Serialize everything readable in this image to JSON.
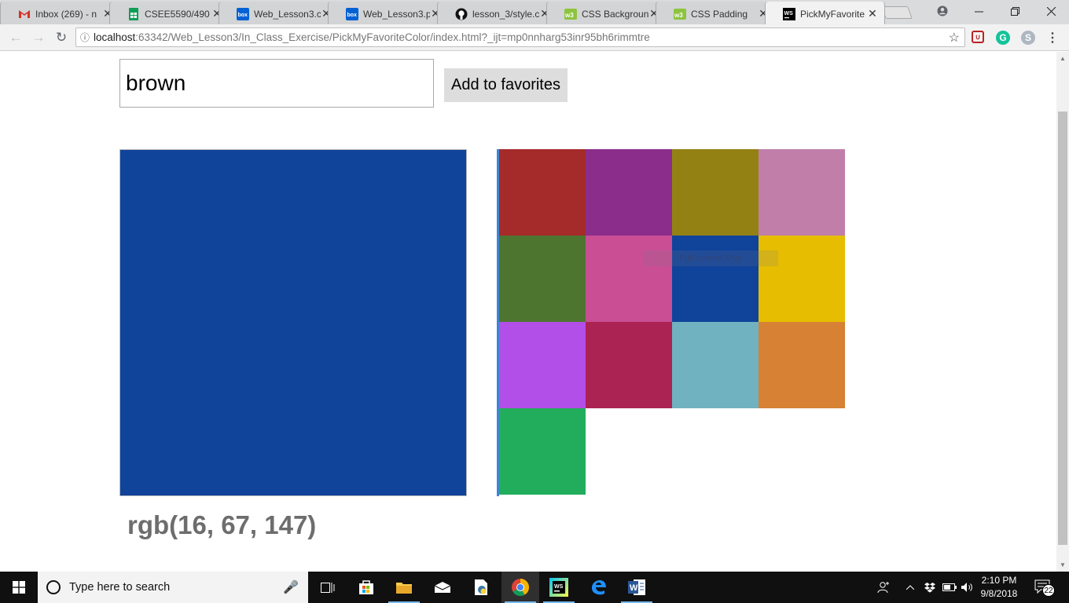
{
  "browser": {
    "tabs": [
      {
        "label": "Inbox (269) - n",
        "icon": "gmail-icon",
        "active": false
      },
      {
        "label": "CSEE5590/490",
        "icon": "sheets-icon",
        "active": false
      },
      {
        "label": "Web_Lesson3.c",
        "icon": "box-icon",
        "active": false
      },
      {
        "label": "Web_Lesson3.p",
        "icon": "box-icon",
        "active": false
      },
      {
        "label": "lesson_3/style.c",
        "icon": "github-icon",
        "active": false
      },
      {
        "label": "CSS Backgroun",
        "icon": "w3schools-icon",
        "active": false
      },
      {
        "label": "CSS Padding",
        "icon": "w3schools-icon",
        "active": false
      },
      {
        "label": "PickMyFavorite",
        "icon": "webstorm-icon",
        "active": true
      }
    ],
    "url_host": "localhost",
    "url_rest": ":63342/Web_Lesson3/In_Class_Exercise/PickMyFavoriteColor/index.html?_ijt=mp0nnharg53inr95bh6rimmtre"
  },
  "page": {
    "input_value": "brown",
    "add_button_label": "Add to favorites",
    "preview_color": "#10439a",
    "rgb_text": "rgb(16, 67, 147)",
    "favorites": [
      "#a52a2a",
      "#8b2e8b",
      "#948113",
      "#c07ea9",
      "#4d7530",
      "#c94e94",
      "#10439a",
      "#e6bd00",
      "#b24fe8",
      "#ab2353",
      "#70b2bf",
      "#d68133",
      "#22ad5c"
    ]
  },
  "overlay": {
    "snip_tooltip": "Full-screen Snip"
  },
  "taskbar": {
    "search_placeholder": "Type here to search",
    "time": "2:10 PM",
    "date": "9/8/2018",
    "notification_count": "22"
  }
}
